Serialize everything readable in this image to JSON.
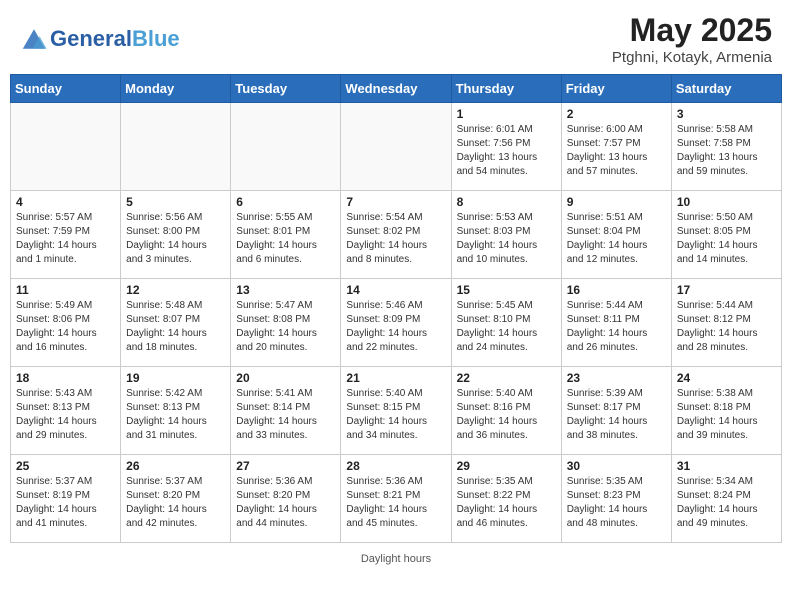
{
  "header": {
    "logo_general": "General",
    "logo_blue": "Blue",
    "title": "May 2025",
    "subtitle": "Ptghni, Kotayk, Armenia"
  },
  "weekdays": [
    "Sunday",
    "Monday",
    "Tuesday",
    "Wednesday",
    "Thursday",
    "Friday",
    "Saturday"
  ],
  "footer": "Daylight hours",
  "weeks": [
    [
      {
        "date": "",
        "sunrise": "",
        "sunset": "",
        "daylight": "",
        "empty": true
      },
      {
        "date": "",
        "sunrise": "",
        "sunset": "",
        "daylight": "",
        "empty": true
      },
      {
        "date": "",
        "sunrise": "",
        "sunset": "",
        "daylight": "",
        "empty": true
      },
      {
        "date": "",
        "sunrise": "",
        "sunset": "",
        "daylight": "",
        "empty": true
      },
      {
        "date": "1",
        "sunrise": "Sunrise: 6:01 AM",
        "sunset": "Sunset: 7:56 PM",
        "daylight": "Daylight: 13 hours and 54 minutes."
      },
      {
        "date": "2",
        "sunrise": "Sunrise: 6:00 AM",
        "sunset": "Sunset: 7:57 PM",
        "daylight": "Daylight: 13 hours and 57 minutes."
      },
      {
        "date": "3",
        "sunrise": "Sunrise: 5:58 AM",
        "sunset": "Sunset: 7:58 PM",
        "daylight": "Daylight: 13 hours and 59 minutes."
      }
    ],
    [
      {
        "date": "4",
        "sunrise": "Sunrise: 5:57 AM",
        "sunset": "Sunset: 7:59 PM",
        "daylight": "Daylight: 14 hours and 1 minute."
      },
      {
        "date": "5",
        "sunrise": "Sunrise: 5:56 AM",
        "sunset": "Sunset: 8:00 PM",
        "daylight": "Daylight: 14 hours and 3 minutes."
      },
      {
        "date": "6",
        "sunrise": "Sunrise: 5:55 AM",
        "sunset": "Sunset: 8:01 PM",
        "daylight": "Daylight: 14 hours and 6 minutes."
      },
      {
        "date": "7",
        "sunrise": "Sunrise: 5:54 AM",
        "sunset": "Sunset: 8:02 PM",
        "daylight": "Daylight: 14 hours and 8 minutes."
      },
      {
        "date": "8",
        "sunrise": "Sunrise: 5:53 AM",
        "sunset": "Sunset: 8:03 PM",
        "daylight": "Daylight: 14 hours and 10 minutes."
      },
      {
        "date": "9",
        "sunrise": "Sunrise: 5:51 AM",
        "sunset": "Sunset: 8:04 PM",
        "daylight": "Daylight: 14 hours and 12 minutes."
      },
      {
        "date": "10",
        "sunrise": "Sunrise: 5:50 AM",
        "sunset": "Sunset: 8:05 PM",
        "daylight": "Daylight: 14 hours and 14 minutes."
      }
    ],
    [
      {
        "date": "11",
        "sunrise": "Sunrise: 5:49 AM",
        "sunset": "Sunset: 8:06 PM",
        "daylight": "Daylight: 14 hours and 16 minutes."
      },
      {
        "date": "12",
        "sunrise": "Sunrise: 5:48 AM",
        "sunset": "Sunset: 8:07 PM",
        "daylight": "Daylight: 14 hours and 18 minutes."
      },
      {
        "date": "13",
        "sunrise": "Sunrise: 5:47 AM",
        "sunset": "Sunset: 8:08 PM",
        "daylight": "Daylight: 14 hours and 20 minutes."
      },
      {
        "date": "14",
        "sunrise": "Sunrise: 5:46 AM",
        "sunset": "Sunset: 8:09 PM",
        "daylight": "Daylight: 14 hours and 22 minutes."
      },
      {
        "date": "15",
        "sunrise": "Sunrise: 5:45 AM",
        "sunset": "Sunset: 8:10 PM",
        "daylight": "Daylight: 14 hours and 24 minutes."
      },
      {
        "date": "16",
        "sunrise": "Sunrise: 5:44 AM",
        "sunset": "Sunset: 8:11 PM",
        "daylight": "Daylight: 14 hours and 26 minutes."
      },
      {
        "date": "17",
        "sunrise": "Sunrise: 5:44 AM",
        "sunset": "Sunset: 8:12 PM",
        "daylight": "Daylight: 14 hours and 28 minutes."
      }
    ],
    [
      {
        "date": "18",
        "sunrise": "Sunrise: 5:43 AM",
        "sunset": "Sunset: 8:13 PM",
        "daylight": "Daylight: 14 hours and 29 minutes."
      },
      {
        "date": "19",
        "sunrise": "Sunrise: 5:42 AM",
        "sunset": "Sunset: 8:13 PM",
        "daylight": "Daylight: 14 hours and 31 minutes."
      },
      {
        "date": "20",
        "sunrise": "Sunrise: 5:41 AM",
        "sunset": "Sunset: 8:14 PM",
        "daylight": "Daylight: 14 hours and 33 minutes."
      },
      {
        "date": "21",
        "sunrise": "Sunrise: 5:40 AM",
        "sunset": "Sunset: 8:15 PM",
        "daylight": "Daylight: 14 hours and 34 minutes."
      },
      {
        "date": "22",
        "sunrise": "Sunrise: 5:40 AM",
        "sunset": "Sunset: 8:16 PM",
        "daylight": "Daylight: 14 hours and 36 minutes."
      },
      {
        "date": "23",
        "sunrise": "Sunrise: 5:39 AM",
        "sunset": "Sunset: 8:17 PM",
        "daylight": "Daylight: 14 hours and 38 minutes."
      },
      {
        "date": "24",
        "sunrise": "Sunrise: 5:38 AM",
        "sunset": "Sunset: 8:18 PM",
        "daylight": "Daylight: 14 hours and 39 minutes."
      }
    ],
    [
      {
        "date": "25",
        "sunrise": "Sunrise: 5:37 AM",
        "sunset": "Sunset: 8:19 PM",
        "daylight": "Daylight: 14 hours and 41 minutes."
      },
      {
        "date": "26",
        "sunrise": "Sunrise: 5:37 AM",
        "sunset": "Sunset: 8:20 PM",
        "daylight": "Daylight: 14 hours and 42 minutes."
      },
      {
        "date": "27",
        "sunrise": "Sunrise: 5:36 AM",
        "sunset": "Sunset: 8:20 PM",
        "daylight": "Daylight: 14 hours and 44 minutes."
      },
      {
        "date": "28",
        "sunrise": "Sunrise: 5:36 AM",
        "sunset": "Sunset: 8:21 PM",
        "daylight": "Daylight: 14 hours and 45 minutes."
      },
      {
        "date": "29",
        "sunrise": "Sunrise: 5:35 AM",
        "sunset": "Sunset: 8:22 PM",
        "daylight": "Daylight: 14 hours and 46 minutes."
      },
      {
        "date": "30",
        "sunrise": "Sunrise: 5:35 AM",
        "sunset": "Sunset: 8:23 PM",
        "daylight": "Daylight: 14 hours and 48 minutes."
      },
      {
        "date": "31",
        "sunrise": "Sunrise: 5:34 AM",
        "sunset": "Sunset: 8:24 PM",
        "daylight": "Daylight: 14 hours and 49 minutes."
      }
    ]
  ]
}
